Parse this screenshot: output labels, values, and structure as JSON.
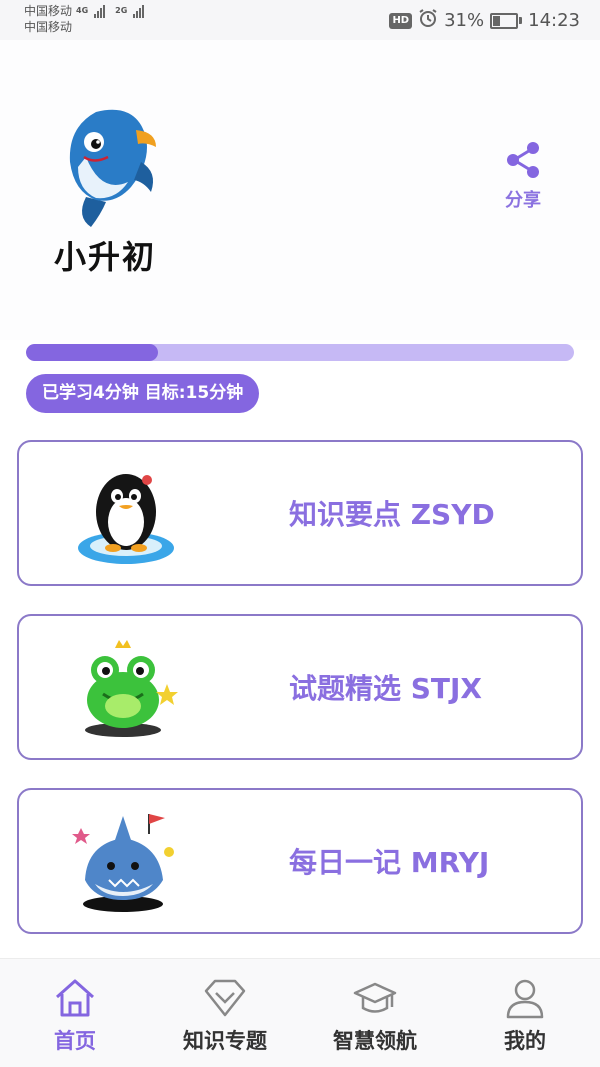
{
  "status_bar": {
    "carrier_1": "中国移动",
    "carrier_2": "中国移动",
    "net_1": "4G",
    "net_2": "2G",
    "hd": "HD",
    "battery_percent": "31%",
    "battery_level": 0.31,
    "time": "14:23"
  },
  "header": {
    "logo_icon": "dolphin-mascot-icon",
    "app_name": "小升初",
    "share_label": "分享"
  },
  "progress": {
    "fraction": 0.24,
    "study_text": "已学习4分钟 目标:15分钟"
  },
  "cards": [
    {
      "icon": "penguin-icon",
      "title": "知识要点 ZSYD"
    },
    {
      "icon": "frog-icon",
      "title": "试题精选 STJX"
    },
    {
      "icon": "shark-icon",
      "title": "每日一记 MRYJ"
    }
  ],
  "tabs": [
    {
      "icon": "home-icon",
      "label": "首页",
      "active": true
    },
    {
      "icon": "diamond-icon",
      "label": "知识专题",
      "active": false
    },
    {
      "icon": "graduation-cap-icon",
      "label": "智慧领航",
      "active": false
    },
    {
      "icon": "user-icon",
      "label": "我的",
      "active": false
    }
  ],
  "colors": {
    "accent": "#8466e0",
    "accent_light": "#c6b9f5",
    "card_border": "#8b79c8"
  }
}
